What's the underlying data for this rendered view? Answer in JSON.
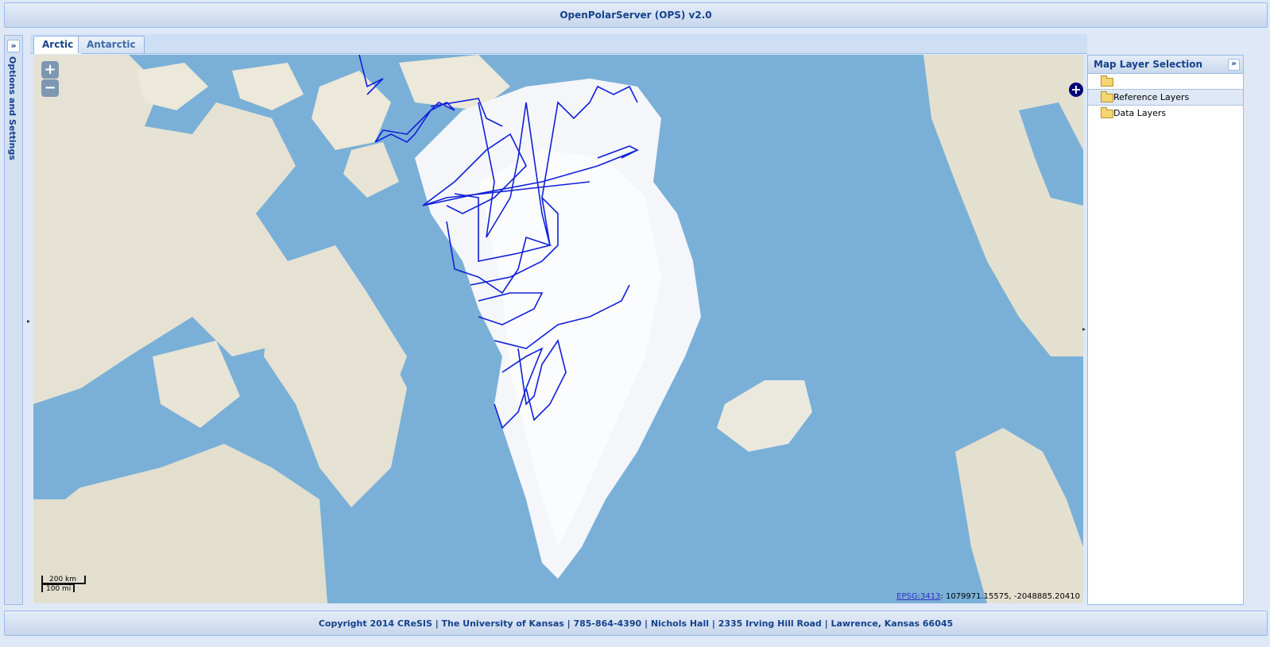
{
  "app": {
    "title": "OpenPolarServer (OPS) v2.0"
  },
  "west_panel": {
    "title": "Options and Settings",
    "expand_icon": "»"
  },
  "tabs": [
    {
      "label": "Arctic",
      "active": true
    },
    {
      "label": "Antarctic",
      "active": false
    }
  ],
  "map": {
    "zoom_in": "+",
    "zoom_out": "−",
    "scale": {
      "km": "200 km",
      "mi": "100 mi"
    },
    "projection_link": "EPSG:3413",
    "coordinates": ": 1079971.15575, -2048885.20410",
    "expand_button": "+",
    "colors": {
      "ocean": "#7ab0d7",
      "land": "#e8e4d6",
      "ice": "#f7f9fc",
      "flight_lines": "#1020d8"
    }
  },
  "layer_panel": {
    "title": "Map Layer Selection",
    "collapse_icon": "»",
    "nodes": [
      {
        "label": "",
        "icon": "folder-icon"
      },
      {
        "label": "Reference Layers",
        "icon": "folder-icon",
        "selected": true
      },
      {
        "label": "Data Layers",
        "icon": "folder-icon"
      }
    ]
  },
  "footer": {
    "text": "Copyright 2014 CReSIS | The University of Kansas | 785-864-4390 | Nichols Hall | 2335 Irving Hill Road | Lawrence, Kansas 66045"
  }
}
